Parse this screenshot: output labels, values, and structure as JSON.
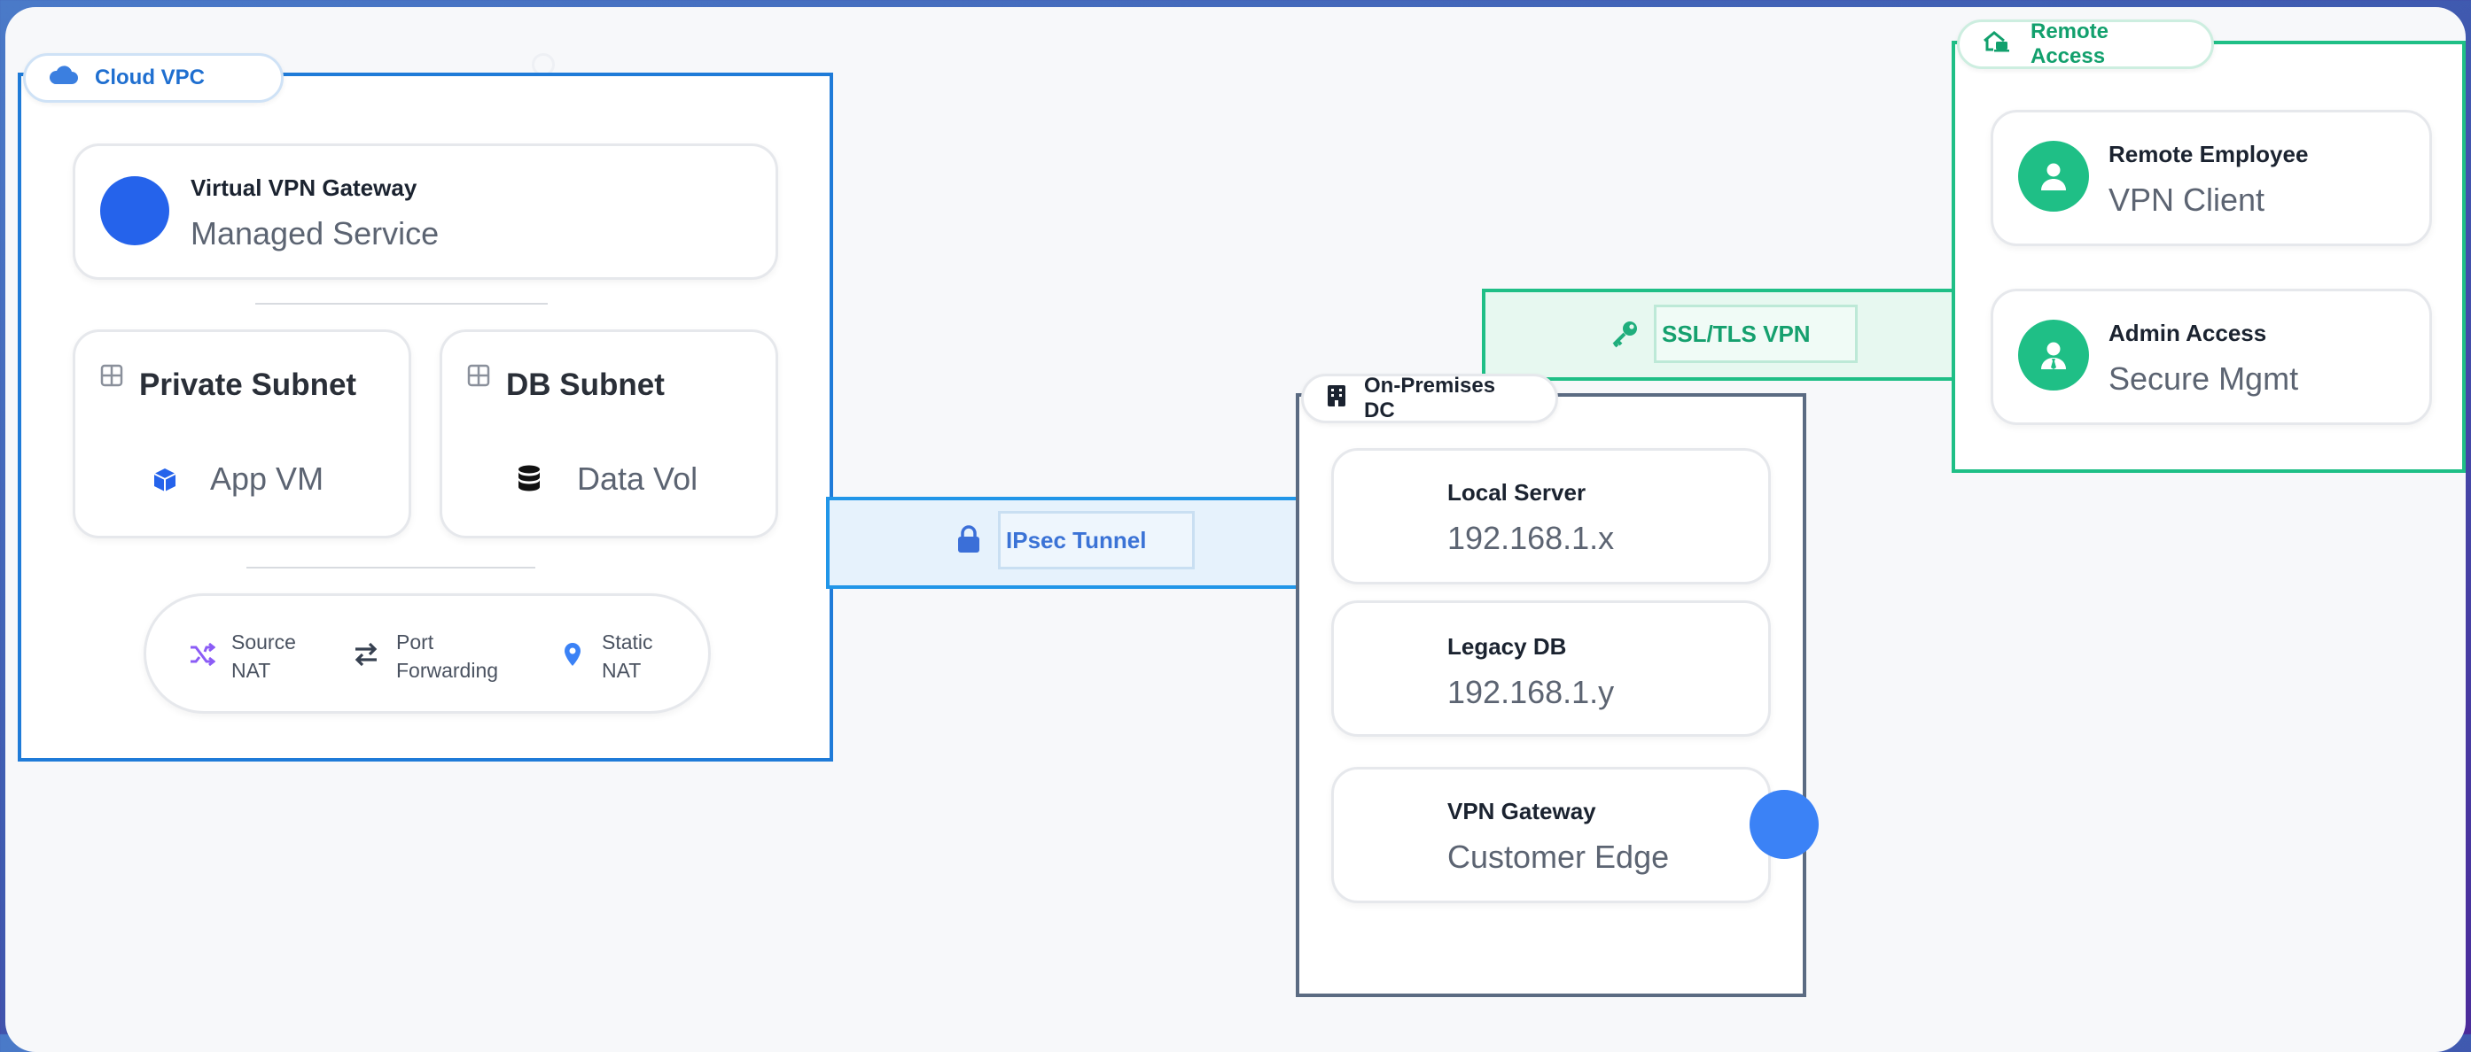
{
  "colors": {
    "cloud_blue": "#1f7bd8",
    "ipsec_blue": "#2196e8",
    "green": "#1fbf86",
    "onprem_gray": "#5b6b82",
    "gateway_dot": "#3b82f6"
  },
  "cloud_vpc": {
    "label": "Cloud VPC",
    "icon": "cloud-icon",
    "gateway": {
      "title": "Virtual VPN Gateway",
      "subtitle": "Managed Service"
    },
    "private_subnet": {
      "title": "Private Subnet",
      "item": "App VM",
      "icon": "cube-icon"
    },
    "db_subnet": {
      "title": "DB Subnet",
      "item": "Data Vol",
      "icon": "database-icon"
    },
    "nat": [
      {
        "line1": "Source",
        "line2": "NAT",
        "icon": "shuffle-icon"
      },
      {
        "line1": "Port",
        "line2": "Forwarding",
        "icon": "swap-arrows-icon"
      },
      {
        "line1": "Static",
        "line2": "NAT",
        "icon": "map-pin-icon"
      }
    ]
  },
  "ipsec": {
    "label": "IPsec Tunnel",
    "icon": "lock-icon"
  },
  "ssl": {
    "label": "SSL/TLS VPN",
    "icon": "key-icon"
  },
  "onprem": {
    "label": "On-Premises DC",
    "icon": "building-icon",
    "servers": [
      {
        "title": "Local Server",
        "subtitle": "192.168.1.x"
      },
      {
        "title": "Legacy DB",
        "subtitle": "192.168.1.y"
      },
      {
        "title": "VPN Gateway",
        "subtitle": "Customer Edge"
      }
    ]
  },
  "remote": {
    "label": "Remote Access",
    "icon": "home-laptop-icon",
    "users": [
      {
        "title": "Remote Employee",
        "subtitle": "VPN Client",
        "icon": "user-icon"
      },
      {
        "title": "Admin Access",
        "subtitle": "Secure Mgmt",
        "icon": "user-tie-icon"
      }
    ]
  }
}
